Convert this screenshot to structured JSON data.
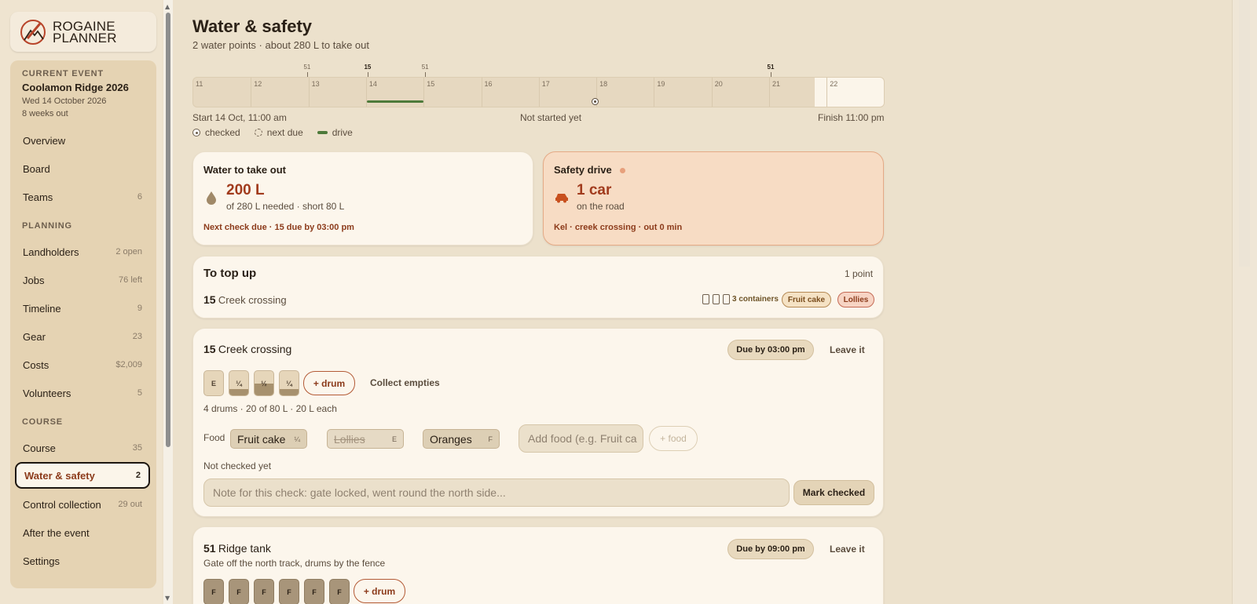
{
  "app": {
    "logo_line1": "ROGAINE",
    "logo_line2": "PLANNER"
  },
  "event": {
    "kicker": "CURRENT EVENT",
    "name": "Coolamon Ridge 2026",
    "date": "Wed 14 October 2026",
    "weeks": "8 weeks out"
  },
  "nav": {
    "overview": "Overview",
    "board": "Board",
    "teams": {
      "label": "Teams",
      "count": "6"
    },
    "planning_head": "PLANNING",
    "landholders": {
      "label": "Landholders",
      "count": "2 open"
    },
    "jobs": {
      "label": "Jobs",
      "count": "76 left"
    },
    "timeline": {
      "label": "Timeline",
      "count": "9"
    },
    "gear": {
      "label": "Gear",
      "count": "23"
    },
    "costs": {
      "label": "Costs",
      "count": "$2,009"
    },
    "volunteers": {
      "label": "Volunteers",
      "count": "5"
    },
    "course_head": "COURSE",
    "course": {
      "label": "Course",
      "count": "35"
    },
    "water": {
      "label": "Water & safety",
      "count": "2"
    },
    "control": {
      "label": "Control collection",
      "count": "29 out"
    },
    "after": "After the event",
    "settings": "Settings"
  },
  "page": {
    "title": "Water & safety",
    "subtitle": "2 water points · about 280 L to take out"
  },
  "timeline": {
    "hours": [
      "11",
      "12",
      "13",
      "14",
      "15",
      "16",
      "17",
      "18",
      "19",
      "20",
      "21",
      "22"
    ],
    "markers": [
      {
        "label": "51",
        "hour": 12.95,
        "kind": "checked",
        "bold": false
      },
      {
        "label": "15",
        "hour": 14.0,
        "kind": "due",
        "bold": true
      },
      {
        "label": "51",
        "hour": 15.0,
        "kind": "checked",
        "bold": false
      },
      {
        "label": "51",
        "hour": 21.0,
        "kind": "due",
        "bold": true
      }
    ],
    "start": "Start 14 Oct, 11:00 am",
    "status": "Not started yet",
    "finish": "Finish 11:00 pm",
    "legend_checked": "checked",
    "legend_due": "next due",
    "legend_drive": "drive"
  },
  "water_card": {
    "title": "Water to take out",
    "amount": "200 L",
    "detail": "of 280 L needed · short 80 L",
    "note": "Next check due · 15 due by 03:00 pm"
  },
  "safety_card": {
    "title": "Safety drive",
    "amount": "1 car",
    "detail": "on the road",
    "note": "Kel · creek crossing · out 0 min"
  },
  "topup": {
    "title": "To top up",
    "count": "1 point",
    "num": "15",
    "name": "Creek crossing",
    "containers": "3 containers",
    "chip1": "Fruit cake",
    "chip2": "Lollies"
  },
  "point15": {
    "num": "15",
    "name": "Creek crossing",
    "due": "Due by 03:00 pm",
    "leave": "Leave it",
    "drums": [
      {
        "label": "E",
        "level": 0
      },
      {
        "label": "¼",
        "level": 0.25
      },
      {
        "label": "½",
        "level": 0.5
      },
      {
        "label": "¼",
        "level": 0.25
      }
    ],
    "add_drum": "+ drum",
    "collect": "Collect empties",
    "summary": "4 drums · 20 of 80 L · 20 L each",
    "food_label": "Food",
    "foods": [
      {
        "name": "Fruit cake",
        "level": "¼"
      },
      {
        "name": "Lollies",
        "level": "E"
      },
      {
        "name": "Oranges",
        "level": "F"
      }
    ],
    "food_placeholder": "Add food (e.g. Fruit ca",
    "add_food": "+ food",
    "status": "Not checked yet",
    "note_placeholder": "Note for this check: gate locked, went round the north side...",
    "mark": "Mark checked"
  },
  "point51": {
    "num": "51",
    "name": "Ridge tank",
    "desc": "Gate off the north track, drums by the fence",
    "due": "Due by 09:00 pm",
    "leave": "Leave it",
    "drums": [
      "F",
      "F",
      "F",
      "F",
      "F",
      "F"
    ],
    "add_drum": "+ drum"
  },
  "colors": {
    "accent": "#a13b1d",
    "drive": "#4d7a3a",
    "alert_bg": "#f7dcc4"
  }
}
